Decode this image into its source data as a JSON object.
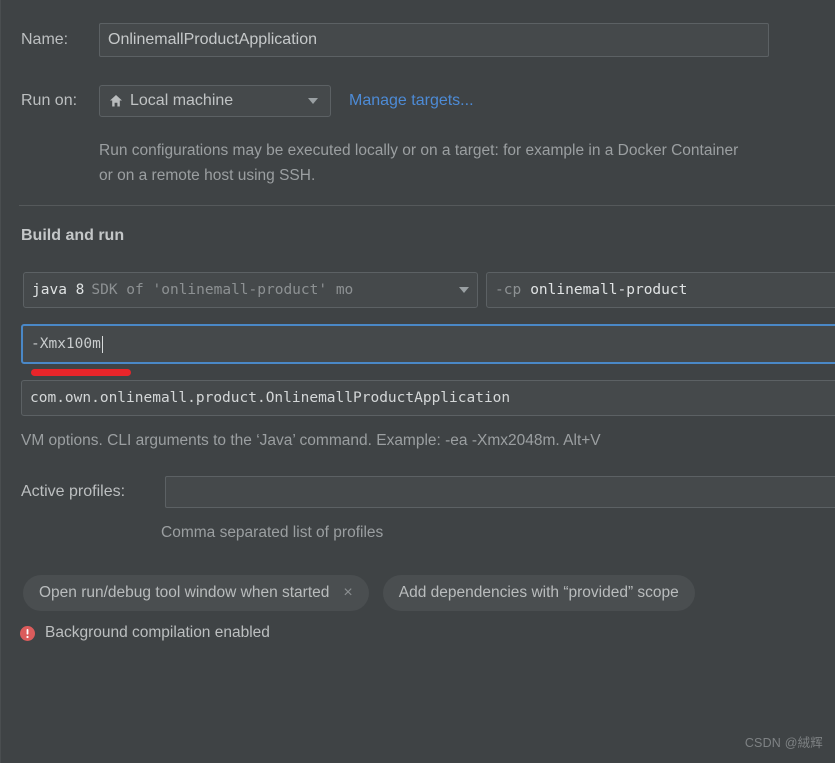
{
  "window": {
    "background": "#3f4345"
  },
  "name_row": {
    "label": "Name:",
    "value": "OnlinemallProductApplication"
  },
  "run_on_row": {
    "label": "Run on:",
    "target_icon": "home-icon",
    "target_value": "Local machine",
    "manage_link": "Manage targets..."
  },
  "description": "Run configurations may be executed locally or on a target: for example in a Docker Container or on a remote host using SSH.",
  "section": {
    "title": "Build and run"
  },
  "build_and_run": {
    "jdk": {
      "name": "java 8",
      "subtitle": "SDK of 'onlinemall-product' mo"
    },
    "classpath": {
      "flag": "-cp",
      "value": "onlinemall-product"
    },
    "vm_options": {
      "value": "-Xmx100m",
      "focus_color": "#4a88c7",
      "annotation_color": "#e8252a"
    },
    "main_class": {
      "value": "com.own.onlinemall.product.OnlinemallProductApplication"
    },
    "hint": "VM options. CLI arguments to the ‘Java’ command. Example: -ea -Xmx2048m. Alt+V"
  },
  "active_profiles": {
    "label": "Active profiles:",
    "value": "",
    "placeholder": "",
    "hint": "Comma separated list of profiles"
  },
  "chips": [
    {
      "label": "Open run/debug tool window when started",
      "removable": true,
      "close_glyph": "×"
    },
    {
      "label": "Add dependencies with “provided” scope",
      "removable": false,
      "close_glyph": ""
    }
  ],
  "status": {
    "icon": "error-icon",
    "icon_color": "#db5c5c",
    "text": "Background compilation enabled"
  },
  "watermark": "CSDN @絨辉"
}
